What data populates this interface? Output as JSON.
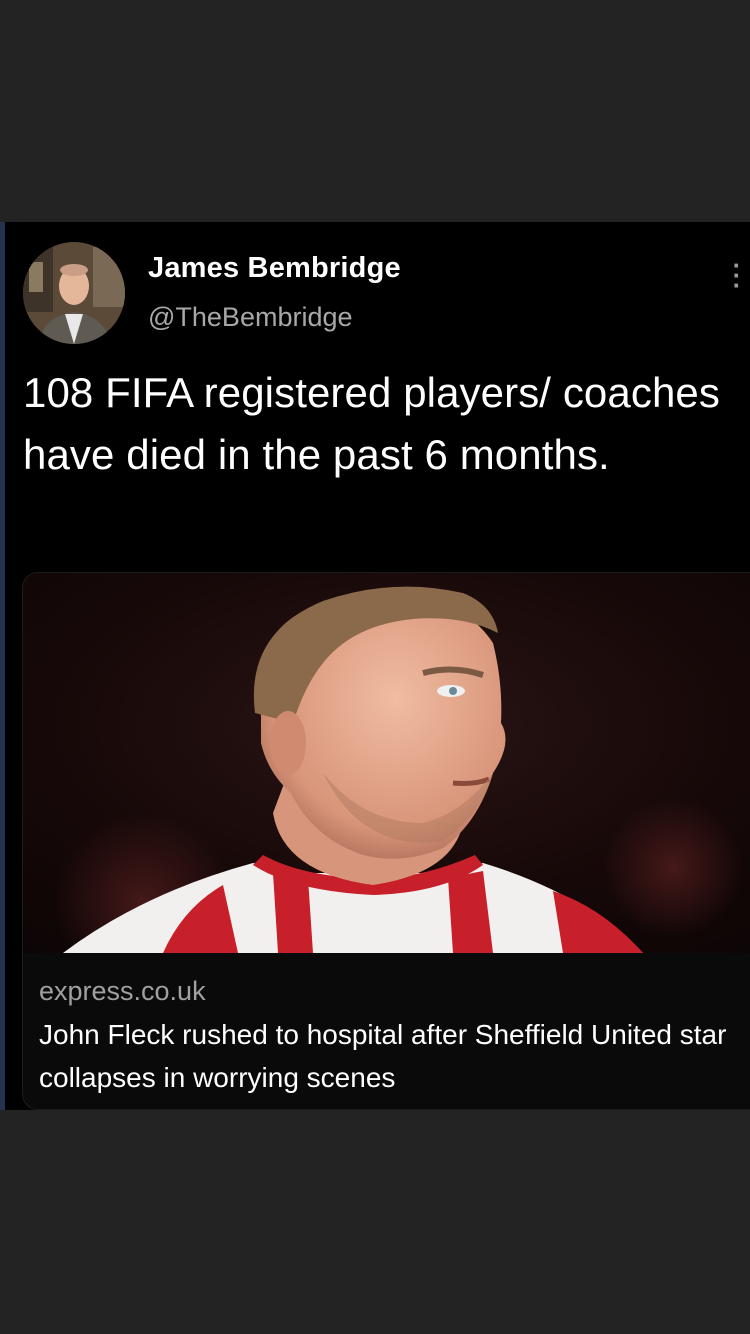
{
  "tweet": {
    "author_name": "James Bembridge",
    "author_handle": "@TheBembridge",
    "text": "108 FIFA registered players/ coaches have died in the past 6 months.",
    "more_icon": "vertical-ellipsis-icon"
  },
  "link_card": {
    "domain": "express.co.uk",
    "title": "John Fleck rushed to hospital after Sheffield United star collapses in worrying scenes"
  },
  "colors": {
    "page_background": "#232323",
    "tweet_background": "#000000",
    "primary_text": "#ffffff",
    "secondary_text": "#a8a8a8",
    "jersey_red": "#c8202a"
  }
}
